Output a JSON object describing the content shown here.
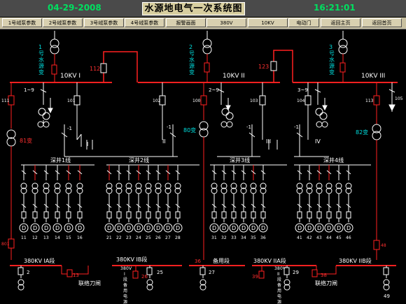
{
  "header": {
    "date": "04-29-2008",
    "time": "16:21:01",
    "title": "水源地电气一次系统图"
  },
  "nav": [
    "1号绒泵参数",
    "2号绒泵参数",
    "3号绒泵参数",
    "4号绒泵参数",
    "报警画面",
    "380V",
    "10KV",
    "电动门",
    "返回主页",
    "返回首页"
  ],
  "colors": {
    "line": "#ffffff",
    "energized": "#ff2020",
    "label_cyan": "#00e0e0",
    "label_red": "#ff3030",
    "background": "#000000",
    "nav_bg": "#c8c0a0"
  },
  "diagram": {
    "transformers": {
      "t1": "1号水源变",
      "t2": "2号水源变",
      "t3": "3号水源变",
      "t1_chars": [
        "1",
        "号",
        "水",
        "源",
        "变"
      ],
      "t2_chars": [
        "2",
        "号",
        "水",
        "源",
        "变"
      ],
      "t3_chars": [
        "3",
        "号",
        "水",
        "源",
        "变"
      ]
    },
    "buses_10kv": [
      "10KV I",
      "10KV II",
      "10KV III"
    ],
    "tie_switches": [
      "112",
      "123"
    ],
    "pt_labels": [
      "1~9",
      "2~9",
      "3~9",
      "105"
    ],
    "feeders": [
      "111",
      "101",
      "102",
      "100",
      "103",
      "104",
      "113"
    ],
    "small_transformers": [
      "81变",
      "80变",
      "82变"
    ],
    "section_marks": [
      "-1",
      "-1",
      "-1",
      "-1"
    ],
    "roman": [
      "I",
      "II",
      "III",
      "IV"
    ],
    "well_groups": [
      "深井1线",
      "深井2线",
      "深井3线",
      "深井4线"
    ],
    "pump_numbers": [
      "11",
      "12",
      "13",
      "14",
      "15",
      "16",
      "21",
      "22",
      "23",
      "24",
      "25",
      "26",
      "27",
      "28",
      "31",
      "32",
      "33",
      "34",
      "35",
      "36",
      "41",
      "42",
      "43",
      "44",
      "45",
      "46"
    ],
    "feeder_breakers": [
      "801",
      "48"
    ],
    "lv_buses": [
      "380KV IA段",
      "380KV IB段",
      "备用段",
      "380KV IIA段",
      "380KV IIB段"
    ],
    "lv_bus_ib_chars": [
      "3",
      "8",
      "0",
      "V",
      "I",
      "段",
      "备",
      "用",
      "电",
      "源"
    ],
    "lv_bus_ii_chars": [
      "3",
      "8",
      "0",
      "V",
      "II",
      "段",
      "备",
      "用",
      "电",
      "源"
    ],
    "lv_feeders": [
      "2",
      "13",
      "25",
      "26",
      "27",
      "39",
      "29",
      "38",
      "49",
      "36"
    ],
    "tie_labels": [
      "联络刀闸",
      "联络刀闸"
    ]
  }
}
